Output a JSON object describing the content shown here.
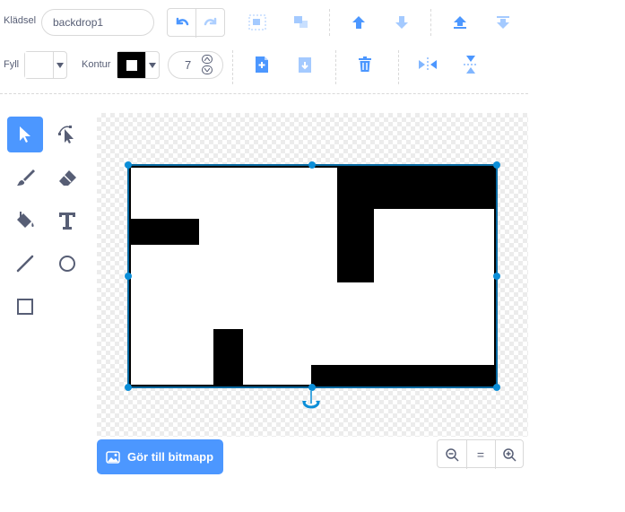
{
  "costume": {
    "label": "Klädsel",
    "name": "backdrop1"
  },
  "fill": {
    "label": "Fyll",
    "color": "#ffffff"
  },
  "outline": {
    "label": "Kontur",
    "color": "#000000"
  },
  "stroke_width": {
    "value": "7"
  },
  "convert_button": {
    "label": "Gör till bitmapp"
  },
  "zoom_reset": {
    "label": "="
  },
  "colors": {
    "accent": "#4c97ff",
    "selection": "#0b8ed8",
    "icon": "#4c97ff",
    "text": "#575e75"
  }
}
